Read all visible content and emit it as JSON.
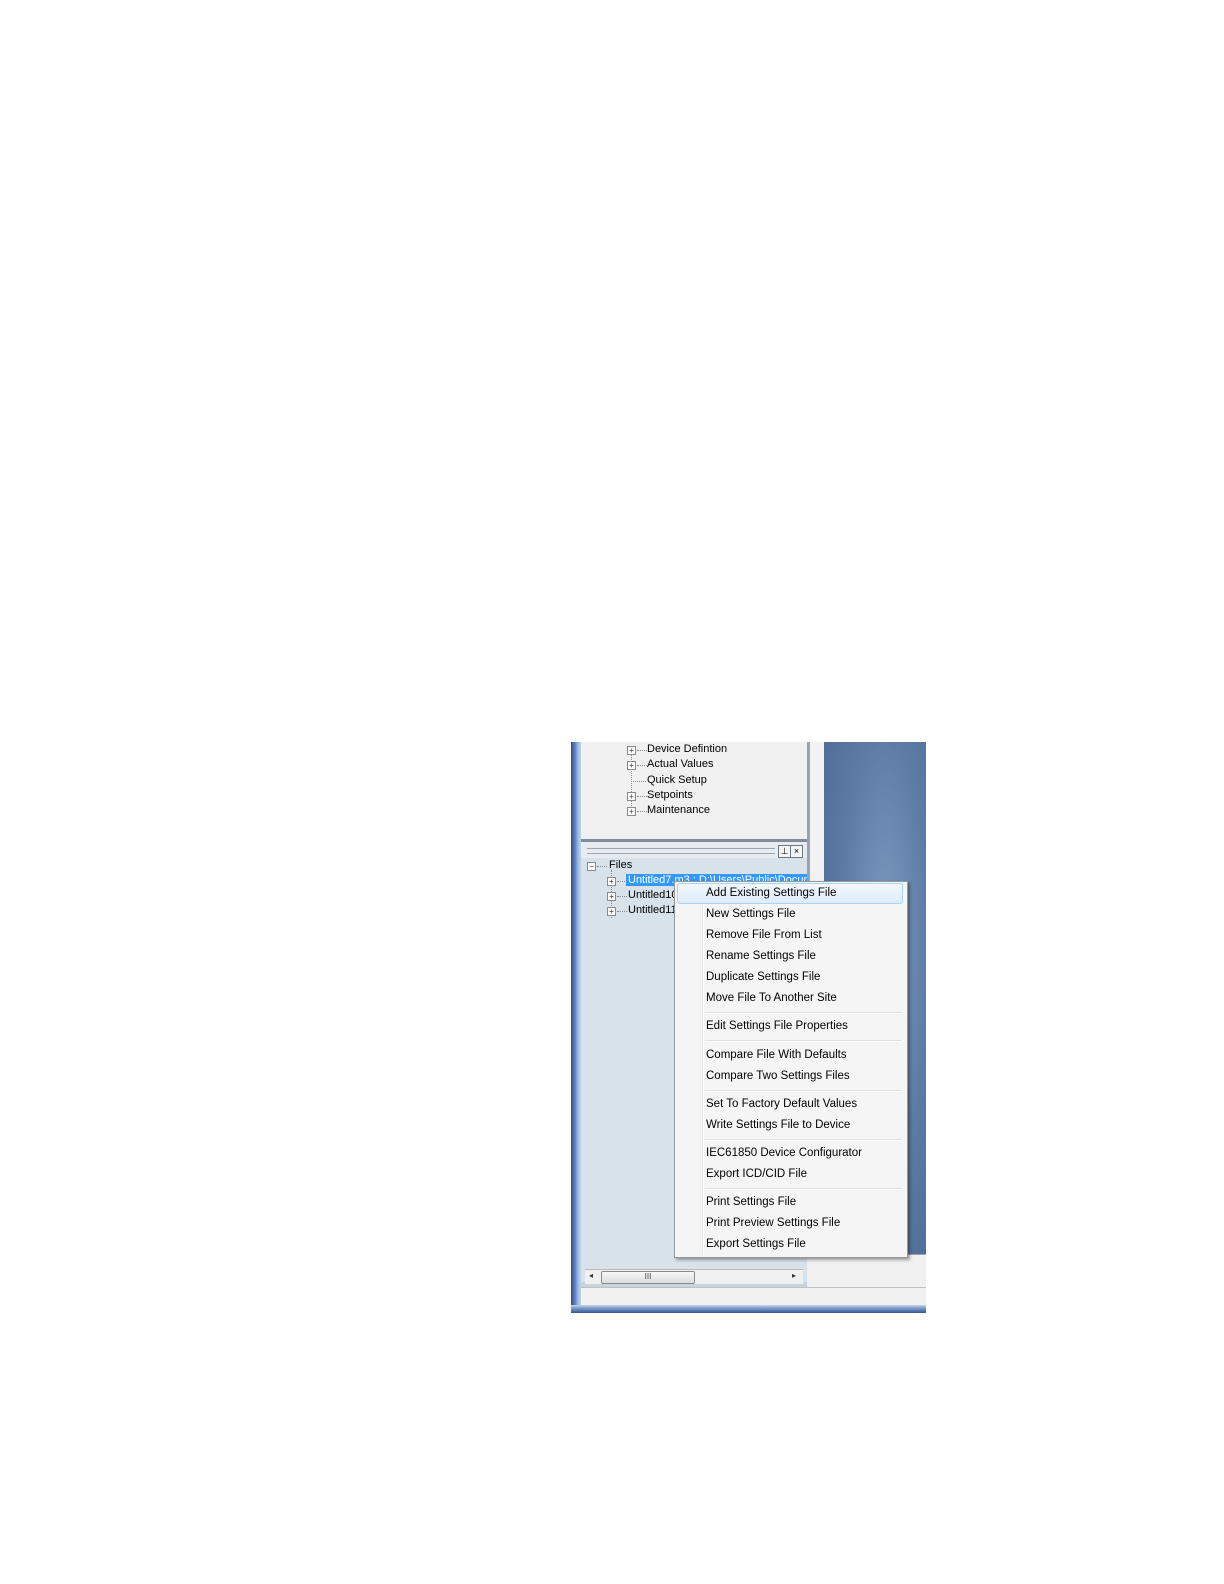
{
  "tree_top": {
    "items": [
      {
        "label": "Device Defintion",
        "expandable": true
      },
      {
        "label": "Actual Values",
        "expandable": true
      },
      {
        "label": "Quick Setup",
        "expandable": false
      },
      {
        "label": "Setpoints",
        "expandable": true
      },
      {
        "label": "Maintenance",
        "expandable": true
      }
    ]
  },
  "files_panel": {
    "pin_button": "⊥",
    "close_button": "×",
    "root_label": "Files",
    "items": [
      {
        "label": "Untitled7.m3 : D:\\Users\\Public\\Docum",
        "selected": true
      },
      {
        "label": "Untitled10",
        "selected": false
      },
      {
        "label": "Untitled11",
        "selected": false
      }
    ],
    "scroll_thumb": "III"
  },
  "context_menu": {
    "groups": [
      [
        "Add Existing Settings File",
        "New Settings File",
        "Remove File From List",
        "Rename Settings File",
        "Duplicate Settings File",
        "Move File To Another Site"
      ],
      [
        "Edit Settings File Properties"
      ],
      [
        "Compare File With Defaults",
        "Compare Two Settings Files"
      ],
      [
        "Set To Factory Default Values",
        "Write Settings File to Device"
      ],
      [
        "IEC61850 Device Configurator",
        "Export ICD/CID File"
      ],
      [
        "Print Settings File",
        "Print Preview Settings File",
        "Export Settings File"
      ]
    ],
    "highlighted": "Add Existing Settings File"
  },
  "colors": {
    "selection": "#3399ff",
    "menu_bg": "#f5f5f5",
    "panel_bg": "#d8e2ea"
  }
}
